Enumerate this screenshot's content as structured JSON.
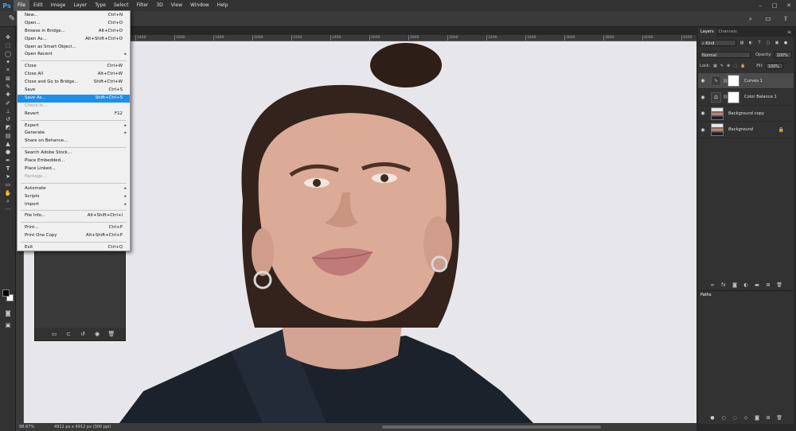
{
  "app": {
    "logo": "Ps"
  },
  "menubar": {
    "items": [
      "File",
      "Edit",
      "Image",
      "Layer",
      "Type",
      "Select",
      "Filter",
      "3D",
      "View",
      "Window",
      "Help"
    ],
    "active": "File"
  },
  "window_controls": {
    "minimize": "–",
    "maximize": "□",
    "close": "✕"
  },
  "file_menu": {
    "groups": [
      [
        {
          "label": "New...",
          "shortcut": "Ctrl+N"
        },
        {
          "label": "Open...",
          "shortcut": "Ctrl+O"
        },
        {
          "label": "Browse in Bridge...",
          "shortcut": "Alt+Ctrl+O"
        },
        {
          "label": "Open As...",
          "shortcut": "Alt+Shift+Ctrl+O"
        },
        {
          "label": "Open as Smart Object...",
          "shortcut": ""
        },
        {
          "label": "Open Recent",
          "shortcut": "",
          "submenu": true
        }
      ],
      [
        {
          "label": "Close",
          "shortcut": "Ctrl+W"
        },
        {
          "label": "Close All",
          "shortcut": "Alt+Ctrl+W"
        },
        {
          "label": "Close and Go to Bridge...",
          "shortcut": "Shift+Ctrl+W"
        },
        {
          "label": "Save",
          "shortcut": "Ctrl+S"
        },
        {
          "label": "Save As...",
          "shortcut": "Shift+Ctrl+S",
          "highlighted": true
        },
        {
          "label": "Check In...",
          "shortcut": "",
          "disabled": true
        },
        {
          "label": "Revert",
          "shortcut": "F12"
        }
      ],
      [
        {
          "label": "Export",
          "shortcut": "",
          "submenu": true
        },
        {
          "label": "Generate",
          "shortcut": "",
          "submenu": true
        },
        {
          "label": "Share on Behance...",
          "shortcut": ""
        }
      ],
      [
        {
          "label": "Search Adobe Stock...",
          "shortcut": ""
        },
        {
          "label": "Place Embedded...",
          "shortcut": ""
        },
        {
          "label": "Place Linked...",
          "shortcut": ""
        },
        {
          "label": "Package...",
          "shortcut": "",
          "disabled": true
        }
      ],
      [
        {
          "label": "Automate",
          "shortcut": "",
          "submenu": true
        },
        {
          "label": "Scripts",
          "shortcut": "",
          "submenu": true
        },
        {
          "label": "Import",
          "shortcut": "",
          "submenu": true
        }
      ],
      [
        {
          "label": "File Info...",
          "shortcut": "Alt+Shift+Ctrl+I"
        }
      ],
      [
        {
          "label": "Print...",
          "shortcut": "Ctrl+P"
        },
        {
          "label": "Print One Copy",
          "shortcut": "Alt+Shift+Ctrl+P"
        }
      ],
      [
        {
          "label": "Exit",
          "shortcut": "Ctrl+Q"
        }
      ]
    ]
  },
  "ruler": {
    "labels": [
      "1400",
      "1600",
      "1800",
      "2000",
      "2200",
      "2400",
      "2600",
      "2800",
      "3000",
      "3200",
      "3400",
      "3600",
      "3800",
      "4000",
      "4200"
    ]
  },
  "status": {
    "zoom": "98.67%",
    "doc_info": "4912 px x 4912 px (300 ppi)"
  },
  "layers_panel": {
    "tabs": [
      "Layers",
      "Channels"
    ],
    "active_tab": "Layers",
    "filter_kind": "Kind",
    "blend_mode": "Normal",
    "opacity_label": "Opacity:",
    "opacity": "100%",
    "lock_label": "Lock:",
    "fill_label": "Fill:",
    "fill": "100%",
    "layers": [
      {
        "name": "Curves 1",
        "kind": "curves",
        "selected": true
      },
      {
        "name": "Color Balance 1",
        "kind": "color-balance",
        "selected": false
      },
      {
        "name": "Background copy",
        "kind": "photo",
        "selected": false
      },
      {
        "name": "Background",
        "kind": "photo",
        "selected": false,
        "locked": true
      }
    ]
  },
  "paths_panel": {
    "title": "Paths"
  },
  "colors": {
    "highlight": "#1e8fe8",
    "canvas_bg": "#e7e6ea",
    "ui_dark": "#323232",
    "ps_blue": "#31a8ff"
  }
}
